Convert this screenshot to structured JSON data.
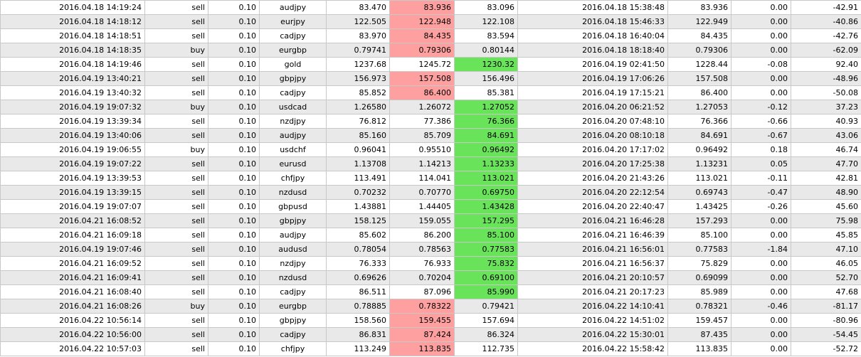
{
  "colors": {
    "row_alt": "#e9e9e9",
    "loss_highlight": "#ffa0a0",
    "profit_highlight": "#69e35a"
  },
  "trades": [
    {
      "open_time": "2016.04.18 14:19:24",
      "type": "sell",
      "volume": "0.10",
      "symbol": "audjpy",
      "open_price": "83.470",
      "sl": "83.936",
      "tp": "83.096",
      "close_time": "2016.04.18 15:38:48",
      "close_price": "83.936",
      "swap": "0.00",
      "profit": "-42.91",
      "hl": "sl"
    },
    {
      "open_time": "2016.04.18 14:18:12",
      "type": "sell",
      "volume": "0.10",
      "symbol": "eurjpy",
      "open_price": "122.505",
      "sl": "122.948",
      "tp": "122.108",
      "close_time": "2016.04.18 15:46:33",
      "close_price": "122.949",
      "swap": "0.00",
      "profit": "-40.86",
      "hl": "sl"
    },
    {
      "open_time": "2016.04.18 14:18:51",
      "type": "sell",
      "volume": "0.10",
      "symbol": "cadjpy",
      "open_price": "83.970",
      "sl": "84.435",
      "tp": "83.594",
      "close_time": "2016.04.18 16:40:04",
      "close_price": "84.435",
      "swap": "0.00",
      "profit": "-42.76",
      "hl": "sl"
    },
    {
      "open_time": "2016.04.18 14:18:35",
      "type": "buy",
      "volume": "0.10",
      "symbol": "eurgbp",
      "open_price": "0.79741",
      "sl": "0.79306",
      "tp": "0.80144",
      "close_time": "2016.04.18 18:18:40",
      "close_price": "0.79306",
      "swap": "0.00",
      "profit": "-62.09",
      "hl": "sl"
    },
    {
      "open_time": "2016.04.18 14:19:46",
      "type": "sell",
      "volume": "0.10",
      "symbol": "gold",
      "open_price": "1237.68",
      "sl": "1245.72",
      "tp": "1230.32",
      "close_time": "2016.04.19 02:41:50",
      "close_price": "1228.44",
      "swap": "-0.08",
      "profit": "92.40",
      "hl": "tp"
    },
    {
      "open_time": "2016.04.19 13:40:21",
      "type": "sell",
      "volume": "0.10",
      "symbol": "gbpjpy",
      "open_price": "156.973",
      "sl": "157.508",
      "tp": "156.496",
      "close_time": "2016.04.19 17:06:26",
      "close_price": "157.508",
      "swap": "0.00",
      "profit": "-48.96",
      "hl": "sl"
    },
    {
      "open_time": "2016.04.19 13:40:32",
      "type": "sell",
      "volume": "0.10",
      "symbol": "cadjpy",
      "open_price": "85.852",
      "sl": "86.400",
      "tp": "85.381",
      "close_time": "2016.04.19 17:15:21",
      "close_price": "86.400",
      "swap": "0.00",
      "profit": "-50.08",
      "hl": "sl"
    },
    {
      "open_time": "2016.04.19 19:07:32",
      "type": "buy",
      "volume": "0.10",
      "symbol": "usdcad",
      "open_price": "1.26580",
      "sl": "1.26072",
      "tp": "1.27052",
      "close_time": "2016.04.20 06:21:52",
      "close_price": "1.27053",
      "swap": "-0.12",
      "profit": "37.23",
      "hl": "tp"
    },
    {
      "open_time": "2016.04.19 13:39:34",
      "type": "sell",
      "volume": "0.10",
      "symbol": "nzdjpy",
      "open_price": "76.812",
      "sl": "77.386",
      "tp": "76.366",
      "close_time": "2016.04.20 07:48:10",
      "close_price": "76.366",
      "swap": "-0.66",
      "profit": "40.93",
      "hl": "tp"
    },
    {
      "open_time": "2016.04.19 13:40:06",
      "type": "sell",
      "volume": "0.10",
      "symbol": "audjpy",
      "open_price": "85.160",
      "sl": "85.709",
      "tp": "84.691",
      "close_time": "2016.04.20 08:10:18",
      "close_price": "84.691",
      "swap": "-0.67",
      "profit": "43.06",
      "hl": "tp"
    },
    {
      "open_time": "2016.04.19 19:06:55",
      "type": "buy",
      "volume": "0.10",
      "symbol": "usdchf",
      "open_price": "0.96041",
      "sl": "0.95510",
      "tp": "0.96492",
      "close_time": "2016.04.20 17:17:02",
      "close_price": "0.96492",
      "swap": "0.18",
      "profit": "46.74",
      "hl": "tp"
    },
    {
      "open_time": "2016.04.19 19:07:22",
      "type": "sell",
      "volume": "0.10",
      "symbol": "eurusd",
      "open_price": "1.13708",
      "sl": "1.14213",
      "tp": "1.13233",
      "close_time": "2016.04.20 17:25:38",
      "close_price": "1.13231",
      "swap": "0.05",
      "profit": "47.70",
      "hl": "tp"
    },
    {
      "open_time": "2016.04.19 13:39:53",
      "type": "sell",
      "volume": "0.10",
      "symbol": "chfjpy",
      "open_price": "113.491",
      "sl": "114.041",
      "tp": "113.021",
      "close_time": "2016.04.20 21:43:26",
      "close_price": "113.021",
      "swap": "-0.11",
      "profit": "42.81",
      "hl": "tp"
    },
    {
      "open_time": "2016.04.19 13:39:15",
      "type": "sell",
      "volume": "0.10",
      "symbol": "nzdusd",
      "open_price": "0.70232",
      "sl": "0.70770",
      "tp": "0.69750",
      "close_time": "2016.04.20 22:12:54",
      "close_price": "0.69743",
      "swap": "-0.47",
      "profit": "48.90",
      "hl": "tp"
    },
    {
      "open_time": "2016.04.19 19:07:07",
      "type": "sell",
      "volume": "0.10",
      "symbol": "gbpusd",
      "open_price": "1.43881",
      "sl": "1.44405",
      "tp": "1.43428",
      "close_time": "2016.04.20 22:40:47",
      "close_price": "1.43425",
      "swap": "-0.26",
      "profit": "45.60",
      "hl": "tp"
    },
    {
      "open_time": "2016.04.21 16:08:52",
      "type": "sell",
      "volume": "0.10",
      "symbol": "gbpjpy",
      "open_price": "158.125",
      "sl": "159.055",
      "tp": "157.295",
      "close_time": "2016.04.21 16:46:28",
      "close_price": "157.293",
      "swap": "0.00",
      "profit": "75.98",
      "hl": "tp"
    },
    {
      "open_time": "2016.04.21 16:09:18",
      "type": "sell",
      "volume": "0.10",
      "symbol": "audjpy",
      "open_price": "85.602",
      "sl": "86.200",
      "tp": "85.100",
      "close_time": "2016.04.21 16:46:39",
      "close_price": "85.100",
      "swap": "0.00",
      "profit": "45.85",
      "hl": "tp"
    },
    {
      "open_time": "2016.04.19 19:07:46",
      "type": "sell",
      "volume": "0.10",
      "symbol": "audusd",
      "open_price": "0.78054",
      "sl": "0.78563",
      "tp": "0.77583",
      "close_time": "2016.04.21 16:56:01",
      "close_price": "0.77583",
      "swap": "-1.84",
      "profit": "47.10",
      "hl": "tp"
    },
    {
      "open_time": "2016.04.21 16:09:52",
      "type": "sell",
      "volume": "0.10",
      "symbol": "nzdjpy",
      "open_price": "76.333",
      "sl": "76.933",
      "tp": "75.832",
      "close_time": "2016.04.21 16:56:37",
      "close_price": "75.829",
      "swap": "0.00",
      "profit": "46.05",
      "hl": "tp"
    },
    {
      "open_time": "2016.04.21 16:09:41",
      "type": "sell",
      "volume": "0.10",
      "symbol": "nzdusd",
      "open_price": "0.69626",
      "sl": "0.70204",
      "tp": "0.69100",
      "close_time": "2016.04.21 20:10:57",
      "close_price": "0.69099",
      "swap": "0.00",
      "profit": "52.70",
      "hl": "tp"
    },
    {
      "open_time": "2016.04.21 16:08:40",
      "type": "sell",
      "volume": "0.10",
      "symbol": "cadjpy",
      "open_price": "86.511",
      "sl": "87.096",
      "tp": "85.990",
      "close_time": "2016.04.21 20:17:23",
      "close_price": "85.989",
      "swap": "0.00",
      "profit": "47.68",
      "hl": "tp"
    },
    {
      "open_time": "2016.04.21 16:08:26",
      "type": "buy",
      "volume": "0.10",
      "symbol": "eurgbp",
      "open_price": "0.78885",
      "sl": "0.78322",
      "tp": "0.79421",
      "close_time": "2016.04.22 14:10:41",
      "close_price": "0.78321",
      "swap": "-0.46",
      "profit": "-81.17",
      "hl": "sl"
    },
    {
      "open_time": "2016.04.22 10:56:14",
      "type": "sell",
      "volume": "0.10",
      "symbol": "gbpjpy",
      "open_price": "158.560",
      "sl": "159.455",
      "tp": "157.694",
      "close_time": "2016.04.22 14:51:02",
      "close_price": "159.457",
      "swap": "0.00",
      "profit": "-80.96",
      "hl": "sl"
    },
    {
      "open_time": "2016.04.22 10:56:00",
      "type": "sell",
      "volume": "0.10",
      "symbol": "cadjpy",
      "open_price": "86.831",
      "sl": "87.424",
      "tp": "86.324",
      "close_time": "2016.04.22 15:30:01",
      "close_price": "87.435",
      "swap": "0.00",
      "profit": "-54.45",
      "hl": "sl"
    },
    {
      "open_time": "2016.04.22 10:57:03",
      "type": "sell",
      "volume": "0.10",
      "symbol": "chfjpy",
      "open_price": "113.249",
      "sl": "113.835",
      "tp": "112.735",
      "close_time": "2016.04.22 15:58:42",
      "close_price": "113.835",
      "swap": "0.00",
      "profit": "-52.72",
      "hl": "sl"
    }
  ]
}
